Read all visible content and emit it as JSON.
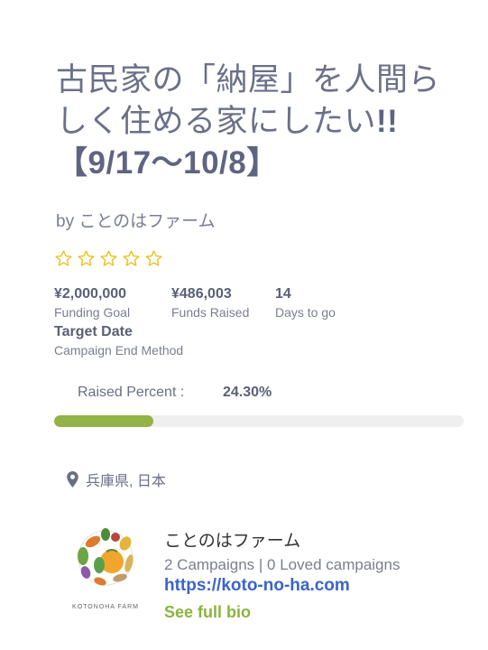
{
  "campaign": {
    "title_line1": "古民家の「納屋」を人間ら",
    "title_line2": "しく住める家にしたい",
    "title_emphasis": "!!",
    "title_line3": "【9/17〜10/8】",
    "byline": "by ことのはファーム",
    "rating": {
      "value": 0,
      "max": 5
    }
  },
  "stats": {
    "funding_goal_value": "¥2,000,000",
    "funding_goal_label": "Funding Goal",
    "funds_raised_value": "¥486,003",
    "funds_raised_label": "Funds Raised",
    "days_value": "14",
    "days_label": "Days to go",
    "end_method_value": "Target Date",
    "end_method_label": "Campaign End Method"
  },
  "progress": {
    "label": "Raised Percent :",
    "value_text": "24.30%",
    "percent": 24.3
  },
  "location": {
    "text": "兵庫県, 日本",
    "icon": "map-pin-icon"
  },
  "creator": {
    "logo_text": "KOTONOHA FARM",
    "name": "ことのはファーム",
    "counts": "2 Campaigns | 0 Loved campaigns",
    "website": "https://koto-no-ha.com",
    "bio_link": "See full bio"
  },
  "colors": {
    "progress_fill": "#93b247",
    "progress_track": "#efefef",
    "link": "#3a64c9",
    "bio_link": "#8ab43d",
    "star": "#e8c21a"
  }
}
